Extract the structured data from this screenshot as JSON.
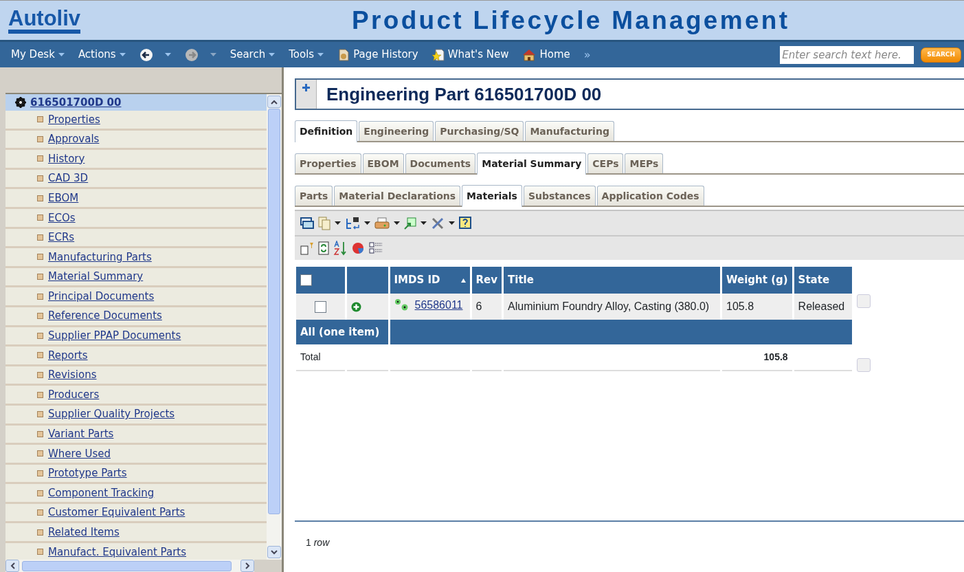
{
  "header": {
    "logo": "Autoliv",
    "title": "Product Lifecycle Management"
  },
  "nav": [
    {
      "kind": "menu",
      "label": "My Desk"
    },
    {
      "kind": "menu",
      "label": "Actions"
    },
    {
      "kind": "back",
      "disabled": false
    },
    {
      "kind": "forward",
      "disabled": true
    },
    {
      "kind": "menu",
      "label": "Search"
    },
    {
      "kind": "menu",
      "label": "Tools"
    },
    {
      "kind": "history",
      "label": "Page History"
    },
    {
      "kind": "news",
      "label": "What's New"
    },
    {
      "kind": "home",
      "label": "Home"
    },
    {
      "kind": "more",
      "label": "»"
    }
  ],
  "search": {
    "placeholder": "Enter search text here.",
    "button": "SEARCH"
  },
  "sidebar": {
    "root": {
      "label": "616501700D 00",
      "selected": true
    },
    "items": [
      "Properties",
      "Approvals",
      "History",
      "CAD 3D",
      "EBOM",
      "ECOs",
      "ECRs",
      "Manufacturing Parts",
      "Material Summary",
      "Principal Documents",
      "Reference Documents",
      "Supplier PPAP Documents",
      "Reports",
      "Revisions",
      "Producers",
      "Supplier Quality Projects",
      "Variant Parts",
      "Where Used",
      "Prototype Parts",
      "Component Tracking",
      "Customer Equivalent Parts",
      "Related Items",
      "Manufact. Equivalent Parts"
    ]
  },
  "page_title": "Engineering Part 616501700D 00",
  "tab_rows": [
    [
      {
        "label": "Definition",
        "selected": true
      },
      {
        "label": "Engineering",
        "selected": false
      },
      {
        "label": "Purchasing/SQ",
        "selected": false
      },
      {
        "label": "Manufacturing",
        "selected": false
      }
    ],
    [
      {
        "label": "Properties",
        "selected": false
      },
      {
        "label": "EBOM",
        "selected": false
      },
      {
        "label": "Documents",
        "selected": false
      },
      {
        "label": "Material Summary",
        "selected": true
      },
      {
        "label": "CEPs",
        "selected": false
      },
      {
        "label": "MEPs",
        "selected": false
      }
    ],
    [
      {
        "label": "Parts",
        "selected": false
      },
      {
        "label": "Material Declarations",
        "selected": false
      },
      {
        "label": "Materials",
        "selected": true
      },
      {
        "label": "Substances",
        "selected": false
      },
      {
        "label": "Application Codes",
        "selected": false
      }
    ]
  ],
  "table": {
    "select_all": {
      "checked": false
    },
    "columns": [
      {
        "label": "IMDS ID",
        "sorted": true
      },
      {
        "label": "Rev",
        "sorted": false
      },
      {
        "label": "Title",
        "sorted": false
      },
      {
        "label": "Weight (g)",
        "sorted": false
      },
      {
        "label": "State",
        "sorted": false
      }
    ],
    "rows": [
      {
        "checked": false,
        "imds_id": "56586011",
        "rev": "6",
        "title": "Aluminium Foundry Alloy, Casting (380.0)",
        "weight": "105.8",
        "state": "Released"
      }
    ],
    "group": "All (one item)",
    "total": {
      "label": "Total",
      "weight": "105.8"
    }
  },
  "footer": "1 *row*"
}
